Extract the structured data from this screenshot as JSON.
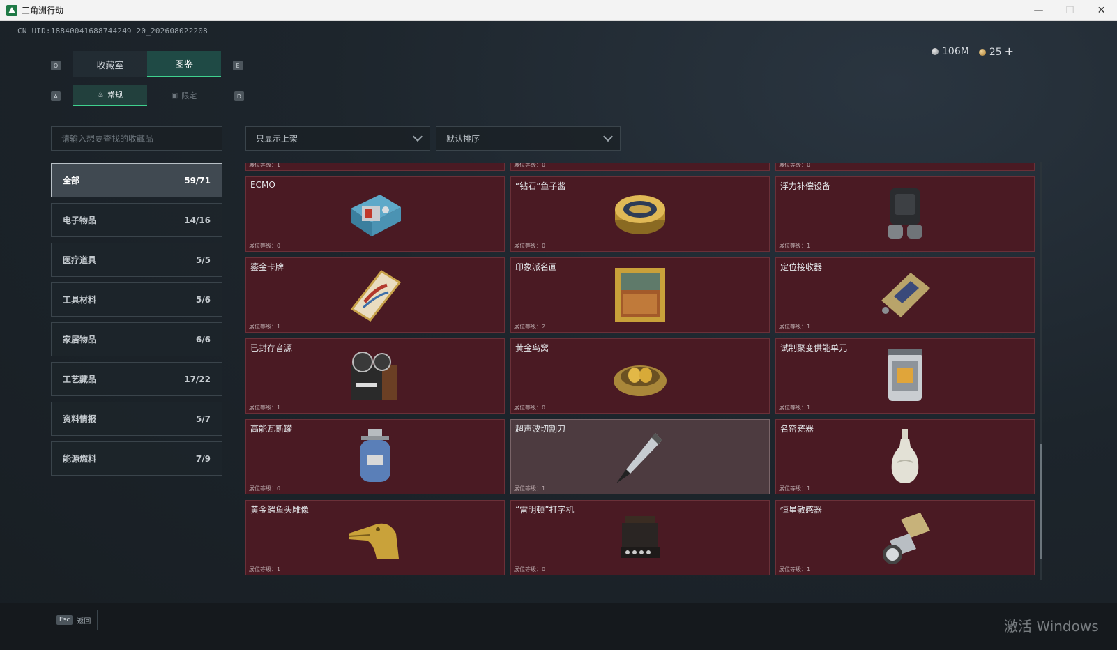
{
  "window": {
    "title": "三角洲行动",
    "minimize": "—",
    "maximize": "☐",
    "close": "✕"
  },
  "header": {
    "uid": "CN UID:18840041688744249 20_202608022208",
    "currency": {
      "silver": "106M",
      "gold": "25",
      "add": "+"
    },
    "key_q": "Q",
    "key_e": "E",
    "key_a": "A",
    "key_d": "D"
  },
  "main_tabs": [
    {
      "label": "收藏室"
    },
    {
      "label": "图鉴"
    }
  ],
  "sub_tabs": [
    {
      "label": "常规"
    },
    {
      "label": "限定"
    }
  ],
  "search": {
    "placeholder": "请输入想要查找的收藏品"
  },
  "filters": {
    "shelf": "只显示上架",
    "sort": "默认排序"
  },
  "categories": [
    {
      "label": "全部",
      "count": "59/71"
    },
    {
      "label": "电子物品",
      "count": "14/16"
    },
    {
      "label": "医疗道具",
      "count": "5/5"
    },
    {
      "label": "工具材料",
      "count": "5/6"
    },
    {
      "label": "家居物品",
      "count": "6/6"
    },
    {
      "label": "工艺藏品",
      "count": "17/22"
    },
    {
      "label": "资料情报",
      "count": "5/7"
    },
    {
      "label": "能源燃料",
      "count": "7/9"
    }
  ],
  "items": [
    {
      "name": "",
      "level": "展位等级：1",
      "icon": "item-partial"
    },
    {
      "name": "",
      "level": "展位等级：0",
      "icon": "item-partial"
    },
    {
      "name": "",
      "level": "展位等级：0",
      "icon": "item-partial"
    },
    {
      "name": "ECMO",
      "level": "展位等级：0",
      "icon": "ecmo-machine"
    },
    {
      "name": "“钻石”鱼子酱",
      "level": "展位等级：0",
      "icon": "caviar-tin"
    },
    {
      "name": "浮力补偿设备",
      "level": "展位等级：1",
      "icon": "buoyancy-device"
    },
    {
      "name": "鎏金卡牌",
      "level": "展位等级：1",
      "icon": "gilded-card"
    },
    {
      "name": "印象派名画",
      "level": "展位等级：2",
      "icon": "framed-painting"
    },
    {
      "name": "定位接收器",
      "level": "展位等级：1",
      "icon": "gps-receiver"
    },
    {
      "name": "已封存音源",
      "level": "展位等级：1",
      "icon": "reel-recorder"
    },
    {
      "name": "黄金鸟窝",
      "level": "展位等级：0",
      "icon": "golden-nest"
    },
    {
      "name": "试制聚变供能单元",
      "level": "展位等级：1",
      "icon": "fusion-cell"
    },
    {
      "name": "高能瓦斯罐",
      "level": "展位等级：0",
      "icon": "gas-canister"
    },
    {
      "name": "超声波切割刀",
      "level": "展位等级：1",
      "icon": "ultrasonic-cutter"
    },
    {
      "name": "名窑瓷器",
      "level": "展位等级：1",
      "icon": "porcelain-vase"
    },
    {
      "name": "黄金鳄鱼头雕像",
      "level": "展位等级：1",
      "icon": "gold-crocodile-statue"
    },
    {
      "name": "“雷明顿”打字机",
      "level": "展位等级：0",
      "icon": "typewriter"
    },
    {
      "name": "恒星敏感器",
      "level": "展位等级：1",
      "icon": "star-sensor"
    }
  ],
  "footer": {
    "esc_key": "Esc",
    "back": "返回"
  },
  "watermark": "激活 Windows",
  "colors": {
    "accent": "#3fd18e",
    "card_bg": "#4a1a23",
    "card_hover": "#4d3b40"
  }
}
